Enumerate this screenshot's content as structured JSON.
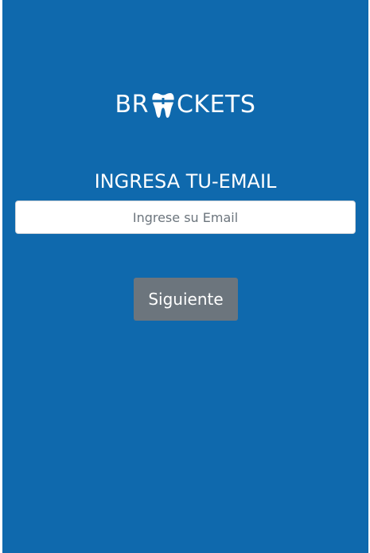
{
  "logo": {
    "text_before": "BR",
    "text_after": "CKETS",
    "icon": "tooth-icon"
  },
  "form": {
    "heading": "INGRESA TU-EMAIL",
    "email_placeholder": "Ingrese su Email",
    "email_value": "",
    "submit_label": "Siguiente"
  },
  "colors": {
    "background": "#0f69ad",
    "button": "#6c757d",
    "text": "#ffffff"
  }
}
